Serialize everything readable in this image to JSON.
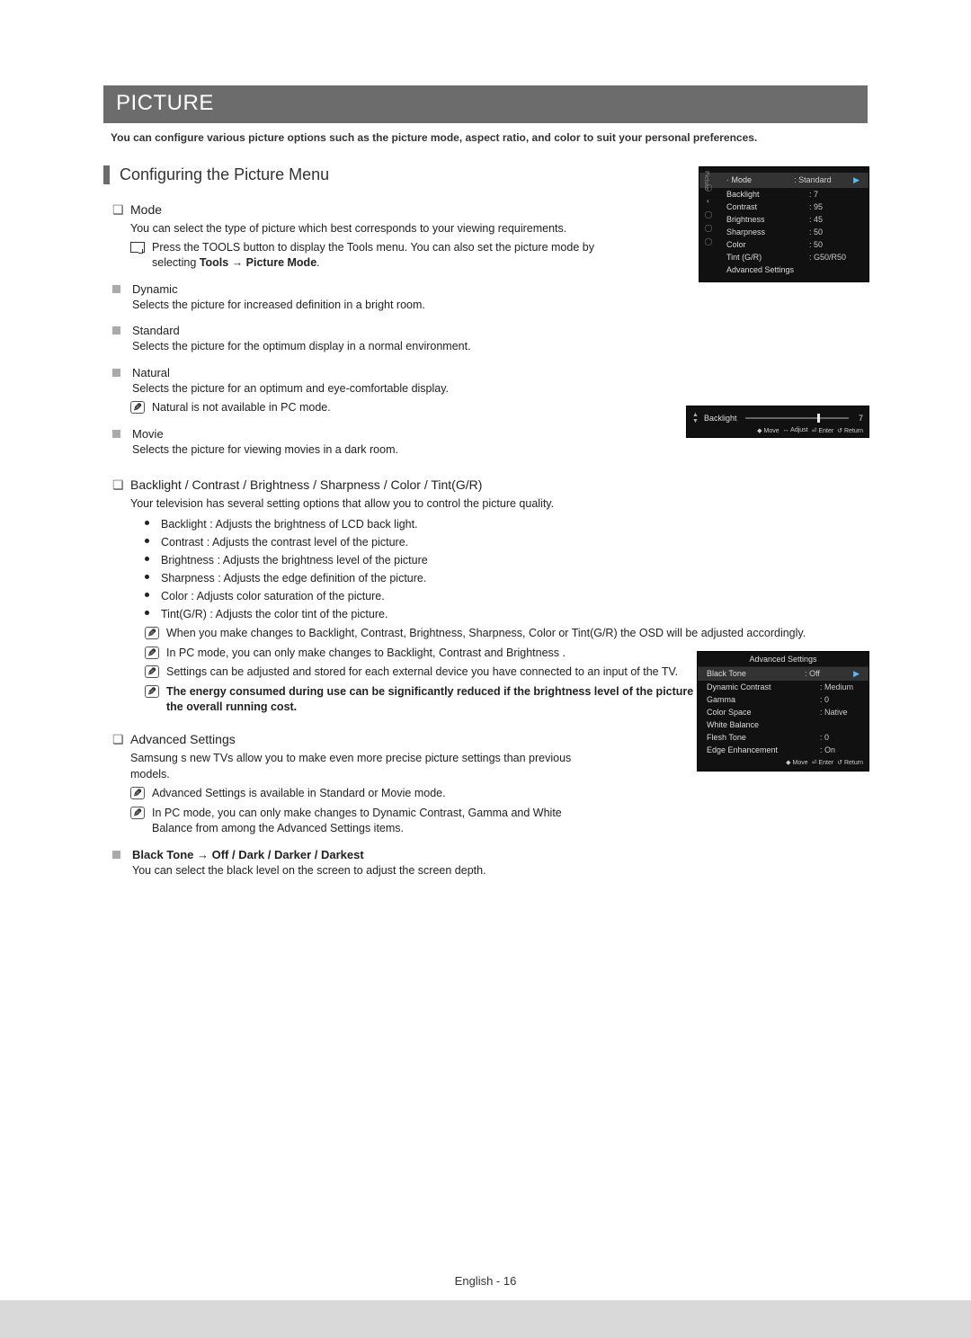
{
  "title": "PICTURE",
  "intro": "You can configure various picture options such as the picture mode, aspect ratio, and color to suit your personal preferences.",
  "section": "Configuring the Picture Menu",
  "mode": {
    "heading": "Mode",
    "desc": "You can select the type of picture which best corresponds to your viewing requirements.",
    "tools_note_prefix": "Press the TOOLS button to display the Tools  menu. You can also set the picture mode by selecting ",
    "tools_note_bold": "Tools → Picture Mode",
    "tools_note_suffix": ".",
    "items": [
      {
        "name": "Dynamic",
        "desc": "Selects the picture for increased definition in a bright room."
      },
      {
        "name": "Standard",
        "desc": "Selects the picture for the optimum display in a normal environment."
      },
      {
        "name": "Natural",
        "desc": "Selects the picture for an optimum and eye-comfortable display.",
        "note": "Natural  is not available in PC mode."
      },
      {
        "name": "Movie",
        "desc": "Selects the picture for viewing movies in a dark room."
      }
    ]
  },
  "quality": {
    "heading": "Backlight / Contrast / Brightness / Sharpness / Color / Tint(G/R)",
    "desc": "Your television has several setting options that allow you to control the picture quality.",
    "bullets": [
      "Backlight : Adjusts the brightness of LCD back light.",
      "Contrast : Adjusts the contrast level of the picture.",
      "Brightness  : Adjusts the brightness level of the picture",
      "Sharpness : Adjusts the edge definition of the picture.",
      "Color : Adjusts color saturation of the picture.",
      "Tint(G/R) : Adjusts the color tint of the picture."
    ],
    "notes": [
      "When you make changes to Backlight, Contrast, Brightness, Sharpness, Color       or Tint(G/R)  the OSD will be adjusted accordingly.",
      "In PC mode, you can only make changes to Backlight, Contrast    and Brightness  .",
      "Settings can be adjusted and stored for each external device you have connected to an input of the TV."
    ],
    "energy_note": "The energy consumed during use can be significantly reduced if the brightness level of the picture is lowered, which will reduce the overall running cost."
  },
  "advanced": {
    "heading": "Advanced Settings",
    "desc": "Samsung s new TVs allow you to make even more precise picture settings than previous models.",
    "notes": [
      "Advanced Settings   is available in Standard  or Movie  mode.",
      "In PC mode, you can only make changes to Dynamic Contrast, Gamma    and White Balance  from among the Advanced Settings   items."
    ],
    "black_tone_label": "Black Tone → Off / Dark / Darker / Darkest",
    "black_tone_desc": "You can select the black level on the screen to adjust the screen depth."
  },
  "osd_picture": {
    "side_label": "Picture",
    "rows": [
      {
        "k": "Mode",
        "v": "Standard",
        "sel": true,
        "dot": true,
        "arrow": true
      },
      {
        "k": "Backlight",
        "v": ": 7"
      },
      {
        "k": "Contrast",
        "v": ": 95"
      },
      {
        "k": "Brightness",
        "v": ": 45"
      },
      {
        "k": "Sharpness",
        "v": ": 50"
      },
      {
        "k": "Color",
        "v": ": 50"
      },
      {
        "k": "Tint (G/R)",
        "v": ": G50/R50"
      },
      {
        "k": "Advanced Settings",
        "v": ""
      }
    ]
  },
  "osd_slider": {
    "label": "Backlight",
    "value": "7",
    "percent": 70,
    "nav": [
      "◆ Move",
      "↔ Adjust",
      "⏎ Enter",
      "↺ Return"
    ]
  },
  "osd_advanced": {
    "title": "Advanced Settings",
    "rows": [
      {
        "k": "Black Tone",
        "v": ": Off",
        "sel": true,
        "arrow": true
      },
      {
        "k": "Dynamic Contrast",
        "v": ": Medium"
      },
      {
        "k": "Gamma",
        "v": ": 0"
      },
      {
        "k": "Color Space",
        "v": ": Native"
      },
      {
        "k": "White Balance",
        "v": ""
      },
      {
        "k": "Flesh Tone",
        "v": ": 0"
      },
      {
        "k": "Edge Enhancement",
        "v": ": On"
      }
    ],
    "nav": [
      "◆ Move",
      "⏎ Enter",
      "↺ Return"
    ]
  },
  "footer": "English - 16"
}
